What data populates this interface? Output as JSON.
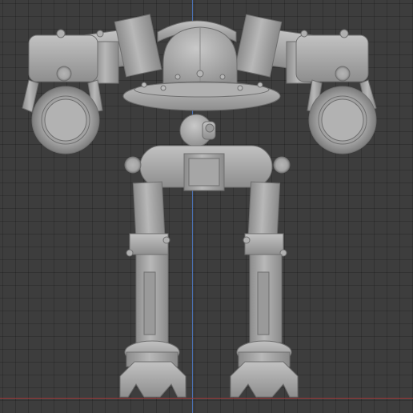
{
  "viewport": {
    "background_color": "#3d3d3d",
    "grid_color": "#353535",
    "z_axis_color": "#4a6fb0",
    "x_axis_color": "#a03a3a"
  },
  "model": {
    "description_icon": "robot-mech-icon",
    "material_color": "#a9a9a9",
    "shadow_color": "#7f7f7f",
    "highlight_color": "#c8c8c8"
  }
}
